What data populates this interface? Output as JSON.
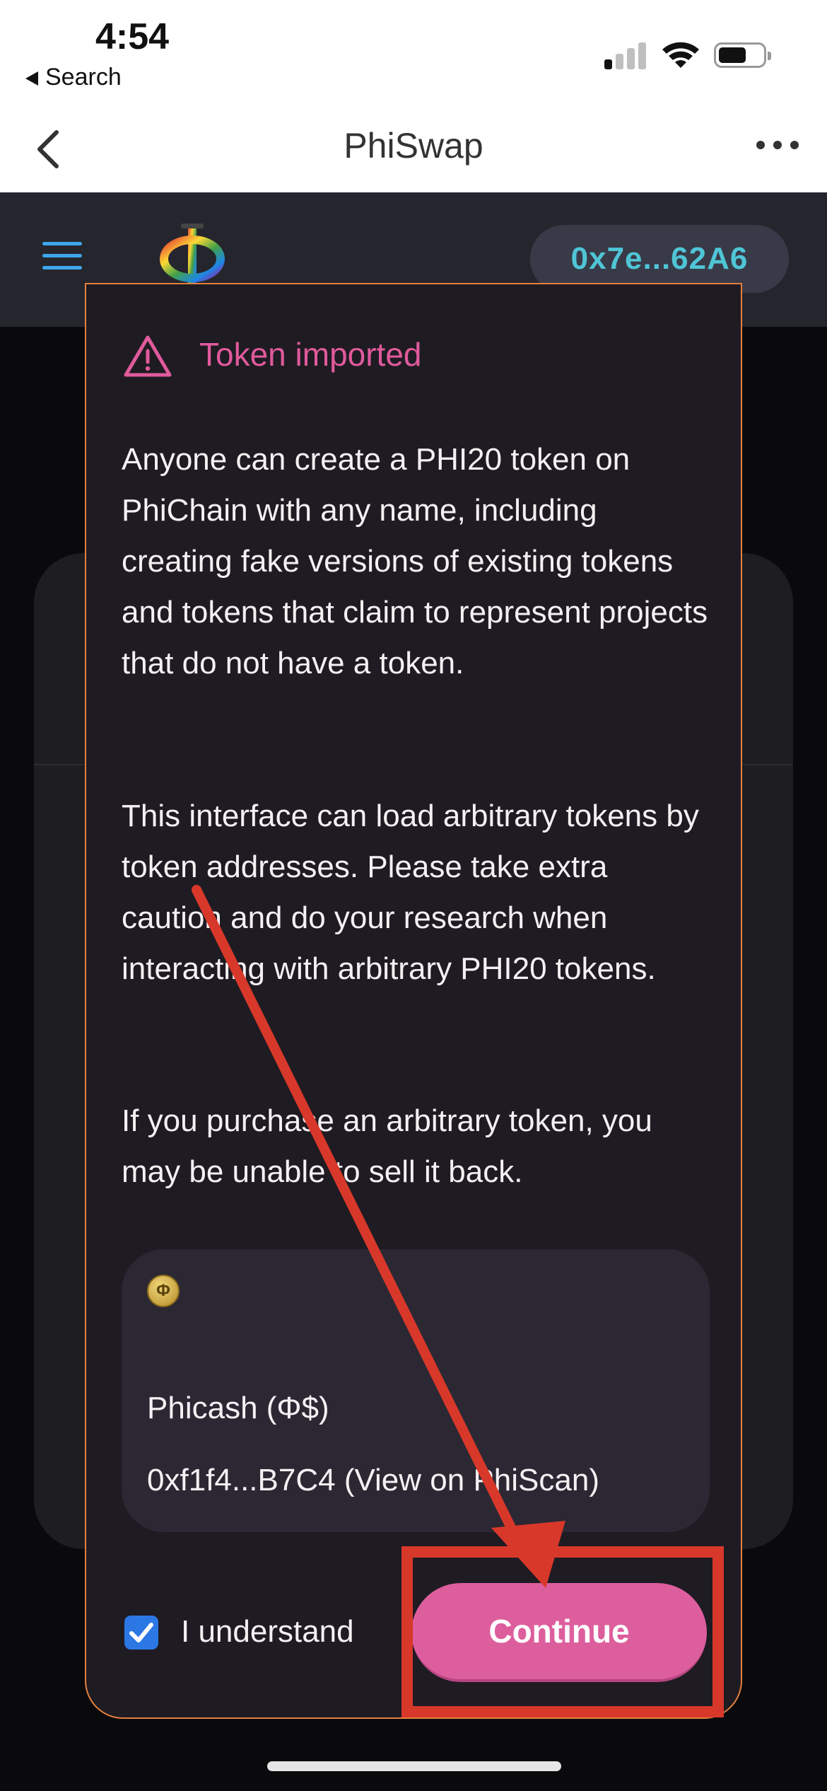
{
  "status_bar": {
    "time": "4:54",
    "back_label": "Search"
  },
  "browser_nav": {
    "title": "PhiSwap"
  },
  "app_header": {
    "logo_icon": "phi-logo",
    "wallet_address": "0x7e...62A6",
    "colors": {
      "menu": "#3ea6ee",
      "wallet_text": "#4fc5d6",
      "wallet_bg": "#393a47"
    }
  },
  "modal": {
    "title": "Token imported",
    "paragraphs": [
      "Anyone can create a PHI20 token on PhiChain with any name, including creating fake versions of existing tokens and tokens that claim to represent projects that do not have a token.",
      "This interface can load arbitrary tokens by token addresses. Please take extra caution and do your research when interacting with arbitrary PHI20 tokens.",
      "If you purchase an arbitrary token, you may be unable to sell it back."
    ],
    "token": {
      "name": "Phicash (Φ$)",
      "address_link": "0xf1f4...B7C4 (View on PhiScan)"
    },
    "checkbox": {
      "label": "I understand",
      "checked": true
    },
    "continue_label": "Continue",
    "colors": {
      "accent": "#dd5e9d",
      "warning": "#e05a9c",
      "border": "#e47f3f",
      "checkbox": "#2b78e4"
    }
  },
  "annotation": {
    "color": "#d8382a"
  }
}
